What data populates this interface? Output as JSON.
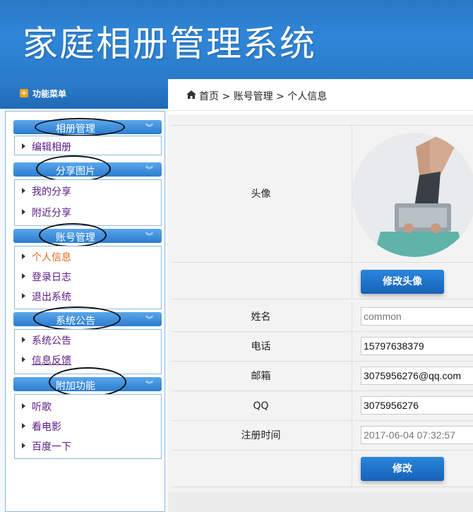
{
  "header": {
    "title": "家庭相册管理系统"
  },
  "sidebar": {
    "title": "功能菜单",
    "groups": [
      {
        "label": "相册管理",
        "items": [
          {
            "label": "编辑相册"
          }
        ]
      },
      {
        "label": "分享图片",
        "items": [
          {
            "label": "我的分享"
          },
          {
            "label": "附近分享"
          }
        ]
      },
      {
        "label": "账号管理",
        "items": [
          {
            "label": "个人信息",
            "active": true
          },
          {
            "label": "登录日志"
          },
          {
            "label": "退出系统"
          }
        ]
      },
      {
        "label": "系统公告",
        "items": [
          {
            "label": "系统公告"
          },
          {
            "label": "信息反馈"
          }
        ]
      },
      {
        "label": "附加功能",
        "items": [
          {
            "label": "听歌"
          },
          {
            "label": "看电影"
          },
          {
            "label": "百度一下"
          }
        ]
      }
    ]
  },
  "breadcrumb": {
    "text": "首页 > 账号管理 > 个人信息"
  },
  "profile": {
    "avatar_label": "头像",
    "change_avatar_button": "修改头像",
    "fields": [
      {
        "label": "姓名",
        "value": "common"
      },
      {
        "label": "电话",
        "value": "15797638379"
      },
      {
        "label": "邮箱",
        "value": "3075956276@qq.com"
      },
      {
        "label": "QQ",
        "value": "3075956276"
      },
      {
        "label": "注册时间",
        "value": "2017-06-04 07:32:57"
      }
    ],
    "submit_button": "修改"
  },
  "colors": {
    "header_blue": "#2f86d8",
    "accent_orange": "#e46a1a",
    "menu_text_purple": "#5a1a86"
  }
}
